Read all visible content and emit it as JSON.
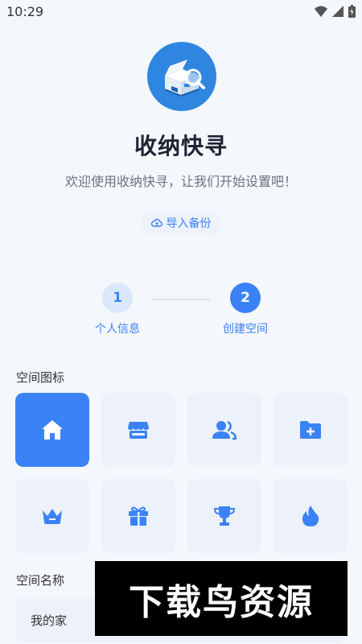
{
  "status_bar": {
    "time": "10:29"
  },
  "app": {
    "title": "收纳快寻",
    "subtitle": "欢迎使用收纳快寻，让我们开始设置吧！",
    "import_label": "导入备份"
  },
  "steps": [
    {
      "number": "1",
      "label": "个人信息",
      "state": "done"
    },
    {
      "number": "2",
      "label": "创建空间",
      "state": "active"
    }
  ],
  "space_icon": {
    "label": "空间图标",
    "options": [
      "home-icon",
      "store-icon",
      "users-icon",
      "folder-plus-icon",
      "crown-icon",
      "gift-icon",
      "trophy-icon",
      "flame-icon"
    ],
    "selected": "home-icon"
  },
  "space_name": {
    "label": "空间名称",
    "value": "我的家"
  },
  "watermark": "下载鸟资源",
  "colors": {
    "accent": "#3b82f6",
    "logo": "#2e86e0",
    "tile_bg": "#edf2fa",
    "background": "#f4f7fc"
  }
}
